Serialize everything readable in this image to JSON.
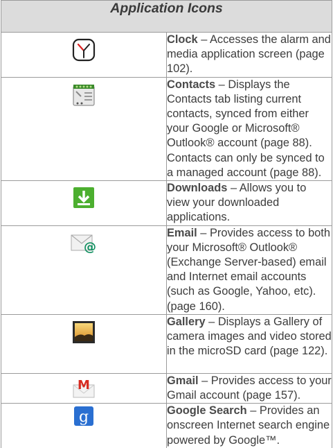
{
  "table": {
    "title": "Application Icons",
    "rows": [
      {
        "name": "Clock",
        "icon": "clock-icon",
        "description": " – Accesses the alarm and media application screen (page 102)."
      },
      {
        "name": "Contacts",
        "icon": "contacts-icon",
        "description": " – Displays the Contacts tab listing current contacts, synced from either your Google or Microsoft® Outlook® account (page 88). Contacts can only be synced to a managed account (page 88)."
      },
      {
        "name": "Downloads",
        "icon": "downloads-icon",
        "description": " – Allows you to view your downloaded applications."
      },
      {
        "name": "Email",
        "icon": "email-icon",
        "description": " – Provides access to both your Microsoft® Outlook® (Exchange Server-based) email and Internet email accounts (such as Google, Yahoo, etc). (page 160)."
      },
      {
        "name": "Gallery",
        "icon": "gallery-icon",
        "description": " – Displays a Gallery of camera images and video stored in the microSD card (page 122)."
      },
      {
        "name": "Gmail",
        "icon": "gmail-icon",
        "description": " – Provides access to your Gmail account (page 157)."
      },
      {
        "name": "Google Search",
        "icon": "google-search-icon",
        "description": " – Provides an onscreen Internet search engine powered by Google™."
      }
    ]
  },
  "colors": {
    "header_bg": "#dcdcdc",
    "border": "#9a9a9a",
    "downloads_green": "#4caf2f",
    "gmail_red": "#d62b20",
    "google_blue": "#2a6fd1"
  }
}
